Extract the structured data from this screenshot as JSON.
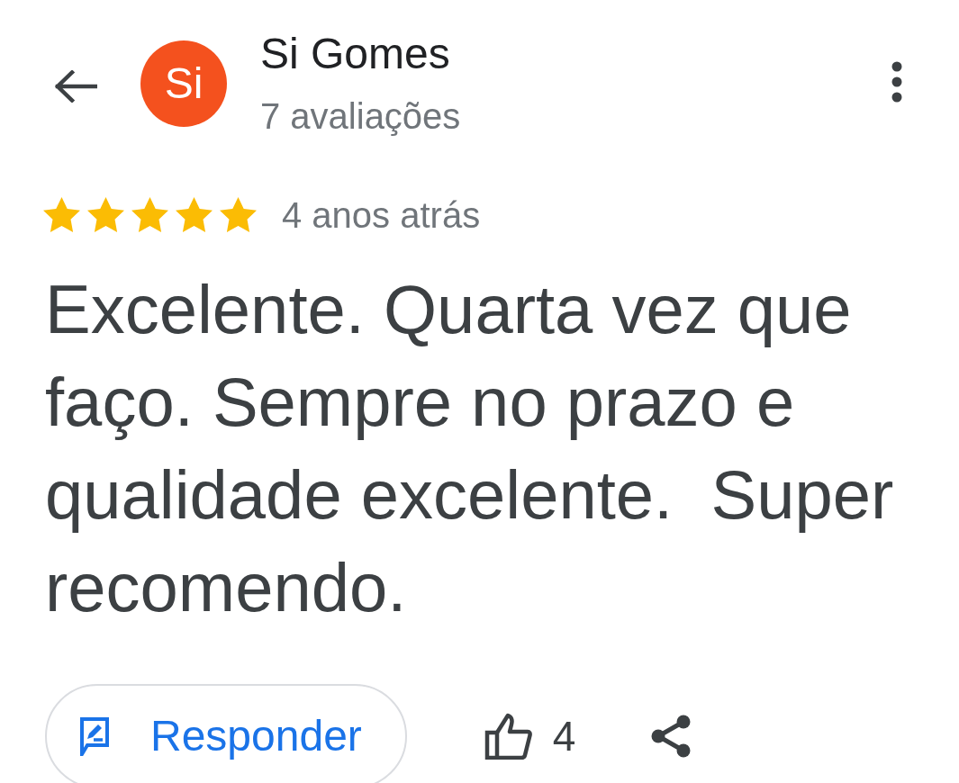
{
  "header": {
    "avatar_initials": "Si",
    "author_name": "Si Gomes",
    "review_count": "7 avaliações"
  },
  "review": {
    "stars": 5,
    "time": "4 anos atrás",
    "text": "Excelente. Quarta vez que faço. Sempre no prazo e qualidade excelente.  Super recomendo."
  },
  "actions": {
    "reply_label": "Responder",
    "like_count": "4"
  }
}
